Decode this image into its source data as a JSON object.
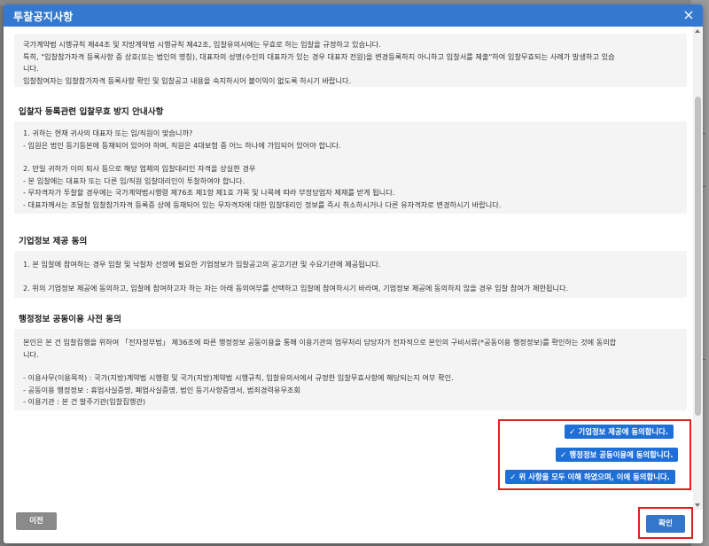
{
  "modal": {
    "title": "투찰공지사항",
    "close_icon": "close-icon"
  },
  "intro": {
    "lines": [
      "국가계약법 시행규칙 제44조 및 지방계약법 시행규칙 제42조, 입찰유의서에는 무효로 하는 입찰을 규정하고 있습니다.",
      "특히, \"입찰참가자격 등록사항 중 상호(또는 법인의 명칭), 대표자의 성명(수인의 대표자가 있는 경우 대표자 전원)을 변경등록하지 아니하고 입찰서를 제출\"하여 입찰무효되는 사례가 발생하고 있습",
      "니다.",
      "입찰참여자는 입찰참가자격 등록사항 확인 및 입찰공고 내용을 숙지하시어 불이익이 없도록 하시기 바랍니다."
    ]
  },
  "section1": {
    "title": "입찰자 등록관련 입찰무효 방지 안내사항",
    "group1": [
      "1. 귀하는 현재 귀사의 대표자 또는 임/직원이 맞습니까?",
      "- 임원은 법인 등기등본에 등재되어 있어야 하며, 직원은 4대보험 중 어느 하나에 가입되어 있어야 합니다."
    ],
    "group2": [
      "2. 만일 귀하가 이미 퇴사 등으로 해당 업체의 입찰대리인 자격을 상실한 경우",
      "- 본 입찰에는 대표자 또는 다른 임/직원 입찰대리인이 투찰하여야 합니다.",
      "- 무자격자가 투찰할 경우에는 국가계약법시행령 제76조 제1항 제1호 가목 및 나목에 따라 부정당업자 제재를 받게 됩니다.",
      "- 대표자께서는 조달청 입찰참가자격 등록증 상에 등재되어 있는 무자격자에 대한 입찰대리인 정보를 즉시 취소하시거나 다른 유자격자로 변경하시기 바랍니다."
    ]
  },
  "section2": {
    "title": "기업정보 제공 동의",
    "lines": [
      "1. 본 입찰에 참여하는 경우 입찰 및 낙찰자 선정에 필요한 기업정보가 입찰공고의 공고기관 및 수요기관에 제공됩니다.",
      "2. 위의 기업정보 제공에 동의하고, 입찰에 참여하고자 하는 자는 아래 동의여부를 선택하고 입찰에 참여하시기 바라며, 기업정보 제공에 동의하지 않을 경우 입찰 참여가 제한됩니다."
    ]
  },
  "section3": {
    "title": "행정정보 공동이용 사전 동의",
    "intro": [
      "본인은 본 건 입찰집행을 위하여 「전자정부법」 제36조에 따른 행정정보 공동이용을 통해 이용기관의 업무처리 담당자가 전자적으로 본인의 구비서류(*공동이용 행정정보)를 확인하는 것에 동의합",
      "니다."
    ],
    "items": [
      "- 이용사무(이용목적) : 국가(지방)계약법 시행령 및 국가(지방)계약법  시행규칙, 입찰유의서에서 규정한 입찰무효사항에 해당되는지 여부 확인.",
      "- 공동이용 행정정보 : 휴업사실증명, 폐업사실증명, 법인 등기사항증명서, 범죄경력유무조회",
      "- 이용기관 : 본 건 발주기관(입찰집행관)"
    ]
  },
  "agree_buttons": {
    "check_icon": "check-icon",
    "company_info": "기업정보 제공에 동의합니다.",
    "admin_info": "행정정보 공동이용에 동의합니다.",
    "all": "위 사항을 모두 이해 하였으며, 이에 동의합니다."
  },
  "footer": {
    "prev": "이전",
    "confirm": "확인"
  },
  "colors": {
    "header": "#3479cf",
    "agree_button": "#1e6fd6",
    "highlight_border": "#e0201e",
    "prev_button": "#8a8a8a",
    "confirm_button": "#3476c9"
  }
}
